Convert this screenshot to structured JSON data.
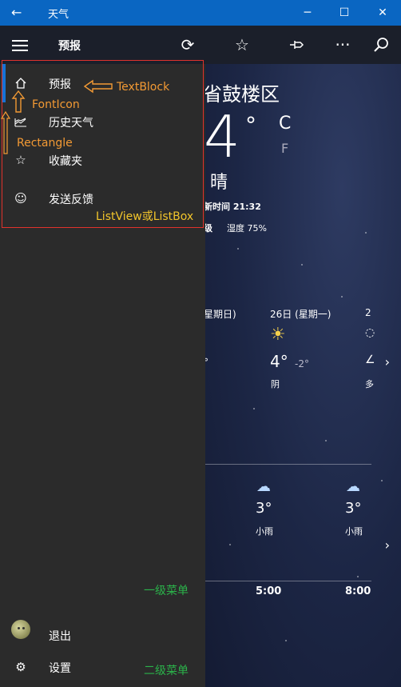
{
  "window": {
    "app_title": "天气"
  },
  "toolbar": {
    "page_title": "预报"
  },
  "nav": {
    "items": [
      {
        "label": "预报",
        "icon": "home-icon"
      },
      {
        "label": "历史天气",
        "icon": "chart-icon"
      },
      {
        "label": "收藏夹",
        "icon": "star-list-icon"
      },
      {
        "label": "发送反馈",
        "icon": "smiley-icon"
      }
    ],
    "bottom": [
      {
        "label": "退出",
        "icon": "avatar"
      },
      {
        "label": "设置",
        "icon": "gear-icon"
      }
    ]
  },
  "weather": {
    "location": "省鼓楼区",
    "temp": "4",
    "deg": "°",
    "unit_c": "C",
    "unit_f": "F",
    "condition": "晴",
    "updated": "新时间 21:32",
    "level": "级",
    "humidity": "湿度  75%",
    "day1": "星期日)",
    "day2": "26日 (星期一)",
    "day3": "2",
    "day1_deg": "°",
    "day2_hi": "4°",
    "day2_lo": "-2°",
    "day2_cond": "阴",
    "day3_cond_partial": "多",
    "hourly": [
      {
        "temp": "3°",
        "cond": "小雨"
      },
      {
        "temp": "3°",
        "cond": "小雨"
      }
    ],
    "times": [
      "5:00",
      "8:00"
    ]
  },
  "annotations": {
    "textblock": "TextBlock",
    "fonticon": "FontIcon",
    "rectangle": "Rectangle",
    "listview": "ListView或ListBox",
    "level1": "一级菜单",
    "level2": "二级菜单"
  },
  "colors": {
    "title_bar": "#0a66c2",
    "pane": "#2b2b2b",
    "selection": "#1673d6",
    "annot_orange": "#f39a34",
    "annot_red": "#e0322c",
    "annot_green": "#2bb24a"
  }
}
